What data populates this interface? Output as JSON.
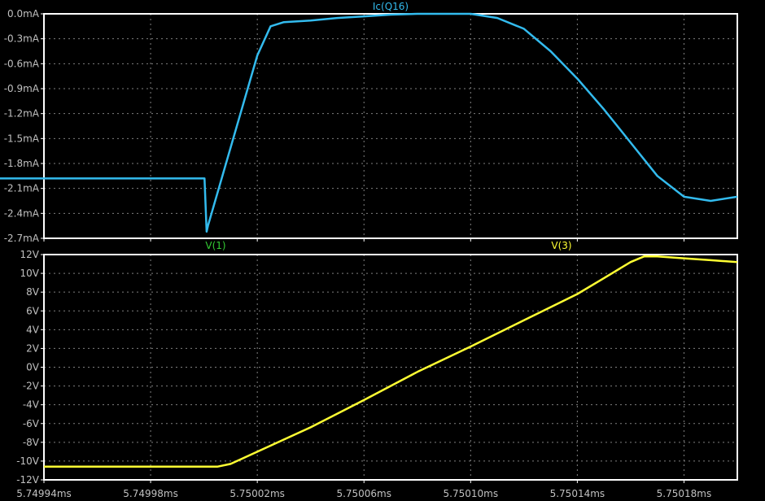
{
  "background": "#000000",
  "frame_color": "#ffffff",
  "grid_color": "#808080",
  "x_axis": {
    "ticks": [
      5.74994,
      5.74998,
      5.75002,
      5.75006,
      5.7501,
      5.75014,
      5.75018
    ],
    "tick_labels": [
      "5.74994ms",
      "5.74998ms",
      "5.75002ms",
      "5.75006ms",
      "5.75010ms",
      "5.75014ms",
      "5.75018ms"
    ],
    "range": [
      5.74994,
      5.7502
    ]
  },
  "chart_data": [
    {
      "type": "line",
      "grid": true,
      "ylim": [
        -2.7,
        0.0
      ],
      "y_ticks": [
        0.0,
        -0.3,
        -0.6,
        -0.9,
        -1.2,
        -1.5,
        -1.8,
        -2.1,
        -2.4,
        -2.7
      ],
      "y_tick_labels": [
        "0.0mA",
        "-0.3mA",
        "-0.6mA",
        "-0.9mA",
        "-1.2mA",
        "-1.5mA",
        "-1.8mA",
        "-2.1mA",
        "-2.4mA",
        "-2.7mA"
      ],
      "series": [
        {
          "name": "Ic(Q16)",
          "color": "#33bbee",
          "x": [
            5.74994,
            5.7499,
            5.74999,
            5.749995,
            5.7500002,
            5.750001,
            5.7500015,
            5.75002,
            5.750025,
            5.75003,
            5.750035,
            5.75004,
            5.75005,
            5.75006,
            5.75007,
            5.75008,
            5.75009,
            5.7501,
            5.75011,
            5.75012,
            5.75013,
            5.75014,
            5.75015,
            5.75016,
            5.75017,
            5.75018,
            5.75019,
            5.7502
          ],
          "y": [
            -1.98,
            -1.98,
            -1.98,
            -1.98,
            -1.98,
            -2.62,
            -2.55,
            -0.5,
            -0.15,
            -0.1,
            -0.09,
            -0.08,
            -0.05,
            -0.03,
            -0.01,
            0.0,
            0.0,
            0.0,
            -0.05,
            -0.18,
            -0.45,
            -0.78,
            -1.15,
            -1.55,
            -1.95,
            -2.2,
            -2.25,
            -2.2
          ]
        }
      ]
    },
    {
      "type": "line",
      "grid": true,
      "ylim": [
        -12,
        12
      ],
      "y_ticks": [
        12,
        10,
        8,
        6,
        4,
        2,
        0,
        -2,
        -4,
        -6,
        -8,
        -10,
        -12
      ],
      "y_tick_labels": [
        "12V",
        "10V",
        "8V",
        "6V",
        "4V",
        "2V",
        "0V",
        "-2V",
        "-4V",
        "-6V",
        "-8V",
        "-10V",
        "-12V"
      ],
      "series": [
        {
          "name": "V(1)",
          "color": "#33cc33",
          "x": [],
          "y": []
        },
        {
          "name": "V(3)",
          "color": "#ffff33",
          "x": [
            5.74994,
            5.74998,
            5.75,
            5.750005,
            5.75001,
            5.75002,
            5.75004,
            5.75006,
            5.75008,
            5.7501,
            5.75012,
            5.75014,
            5.75015,
            5.75016,
            5.750165,
            5.75017,
            5.75018,
            5.75019,
            5.7502
          ],
          "y": [
            -10.6,
            -10.6,
            -10.6,
            -10.6,
            -10.3,
            -9.0,
            -6.4,
            -3.5,
            -0.5,
            2.2,
            5.0,
            7.8,
            9.5,
            11.2,
            11.8,
            11.8,
            11.6,
            11.4,
            11.2
          ]
        }
      ]
    }
  ]
}
